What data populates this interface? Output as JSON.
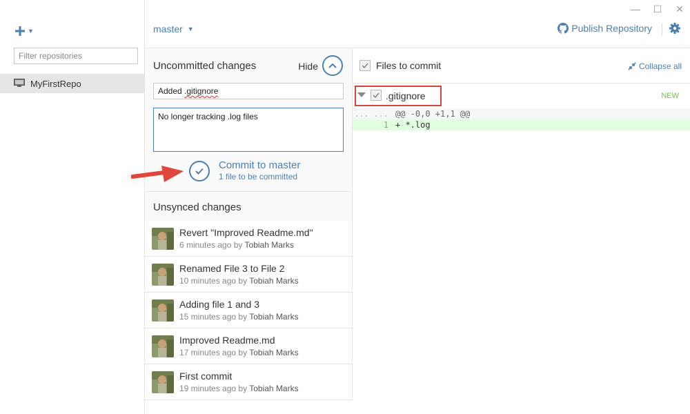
{
  "window": {
    "minimize": "—",
    "maximize": "☐",
    "close": "✕"
  },
  "sidebar": {
    "add_icon": "plus-icon",
    "filter_placeholder": "Filter repositories",
    "repos": [
      {
        "name": "MyFirstRepo"
      }
    ]
  },
  "topbar": {
    "branch": "master",
    "publish_label": "Publish Repository",
    "settings_icon": "gear-icon"
  },
  "commit_panel": {
    "title": "Uncommitted changes",
    "hide_label": "Hide",
    "summary_prefix": "Added ",
    "summary_word": ".gitignore",
    "description": "No longer tracking .log files",
    "commit_label": "Commit to master",
    "commit_sub": "1 file to be committed"
  },
  "unsynced": {
    "title": "Unsynced changes",
    "by": "by",
    "commits": [
      {
        "message": "Revert \"Improved Readme.md\"",
        "time": "6 minutes ago",
        "author": "Tobiah Marks"
      },
      {
        "message": "Renamed File 3 to File 2",
        "time": "10 minutes ago",
        "author": "Tobiah Marks"
      },
      {
        "message": "Adding file 1 and 3",
        "time": "15 minutes ago",
        "author": "Tobiah Marks"
      },
      {
        "message": "Improved Readme.md",
        "time": "17 minutes ago",
        "author": "Tobiah Marks"
      },
      {
        "message": "First commit",
        "time": "19 minutes ago",
        "author": "Tobiah Marks"
      }
    ]
  },
  "files": {
    "header": "Files to commit",
    "collapse_label": "Collapse all",
    "items": [
      {
        "name": ".gitignore",
        "status": "NEW"
      }
    ]
  },
  "diff": {
    "hunk": {
      "old": "...",
      "new": "...",
      "text": "@@ -0,0 +1,1 @@"
    },
    "lines": [
      {
        "old": "",
        "new": "1",
        "text": "+ *.log"
      }
    ]
  },
  "colors": {
    "accent": "#4a7fb5",
    "added_bg": "#dfffdf",
    "new_badge": "#6cc644",
    "highlight": "#d9453a"
  }
}
